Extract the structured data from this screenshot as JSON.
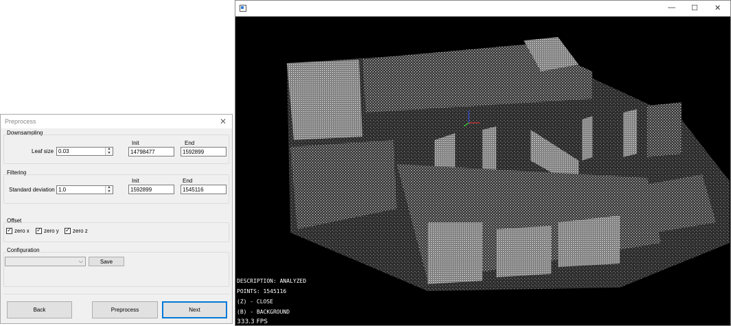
{
  "dialog": {
    "title": "Preprocess",
    "close_symbol": "✕",
    "downsampling": {
      "label": "Downsampling",
      "leaf_size_label": "Leaf size",
      "leaf_size_value": "0.03",
      "init_label": "Init",
      "init_value": "14798477",
      "end_label": "End",
      "end_value": "1592899"
    },
    "filtering": {
      "label": "Filtering",
      "std_dev_label": "Standard deviation",
      "std_dev_value": "1.0",
      "init_label": "Init",
      "init_value": "1592899",
      "end_label": "End",
      "end_value": "1545116"
    },
    "offset": {
      "label": "Offset",
      "zero_x": "zero x",
      "zero_y": "zero y",
      "zero_z": "zero z",
      "checked": [
        true,
        true,
        true
      ]
    },
    "configuration": {
      "label": "Configuration",
      "selected": "",
      "save_label": "Save"
    },
    "buttons": {
      "back": "Back",
      "preprocess": "Preprocess",
      "next": "Next"
    }
  },
  "viewer": {
    "window_buttons": {
      "minimize": "—",
      "maximize": "☐",
      "close": "✕"
    },
    "overlay": {
      "description": "DESCRIPTION: ANALYZED",
      "points": "POINTS: 1545116",
      "close_hint": "(Z) - CLOSE",
      "background_hint": "(B) - BACKGROUND",
      "fps": "333.3 FPS"
    }
  },
  "colors": {
    "accent": "#0078d7",
    "dialog_bg": "#f0f0f0",
    "viewer_bg": "#000000"
  }
}
